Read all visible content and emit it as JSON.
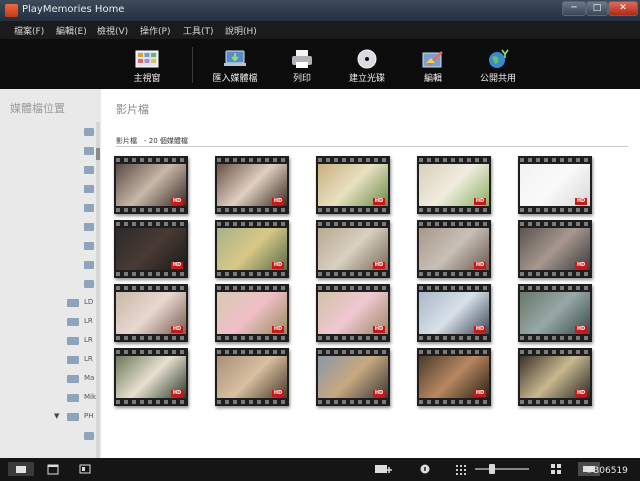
{
  "window": {
    "title": "PlayMemories Home",
    "buttons": {
      "minimize": "─",
      "maximize": "□",
      "close": "✕"
    }
  },
  "menu": [
    "檔案(F)",
    "編輯(E)",
    "檢視(V)",
    "操作(P)",
    "工具(T)",
    "說明(H)"
  ],
  "toolbar": [
    {
      "label": "主視窗",
      "icon": "main-window-icon"
    },
    {
      "label": "匯入媒體檔",
      "icon": "import-icon"
    },
    {
      "label": "列印",
      "icon": "printer-icon"
    },
    {
      "label": "建立光碟",
      "icon": "disc-icon"
    },
    {
      "label": "編輯",
      "icon": "edit-icon"
    },
    {
      "label": "公開共用",
      "icon": "globe-share-icon"
    }
  ],
  "sidebar": {
    "title": "媒體檔位置",
    "folders": [
      "",
      "",
      "",
      "",
      "",
      "",
      "",
      "",
      "",
      "LD",
      "LR",
      "LR",
      "LR",
      "Ma",
      "Mik",
      "PH",
      ""
    ]
  },
  "main": {
    "heading": "影片檔",
    "subheading": "影片檔　- 20 個媒體檔",
    "badge": "HD",
    "thumbnails": [
      {
        "colors": [
          "#5a4a45",
          "#c8b8a8",
          "#3a2a2a"
        ],
        "hd": true
      },
      {
        "colors": [
          "#6a5048",
          "#e0d0c0",
          "#3a2a22"
        ],
        "hd": true
      },
      {
        "colors": [
          "#c8b080",
          "#e8e0c0",
          "#6a8a4a"
        ],
        "hd": true
      },
      {
        "colors": [
          "#d8d0b8",
          "#f0ece0",
          "#8ab060"
        ],
        "hd": true
      },
      {
        "colors": [
          "#f2f2f2",
          "#fafafa",
          "#d8d8d8"
        ],
        "hd": true
      },
      {
        "colors": [
          "#2a2a2a",
          "#4a3a34",
          "#1a1a1a"
        ],
        "hd": true
      },
      {
        "colors": [
          "#a8b088",
          "#d8c888",
          "#5a6a48"
        ],
        "hd": true
      },
      {
        "colors": [
          "#b8a890",
          "#d8d0c0",
          "#7a6a58"
        ],
        "hd": true
      },
      {
        "colors": [
          "#a89888",
          "#c8c0b8",
          "#6a5a50"
        ],
        "hd": true
      },
      {
        "colors": [
          "#5a5450",
          "#a89890",
          "#3a3a3a"
        ],
        "hd": true
      },
      {
        "colors": [
          "#c8b8a8",
          "#e8d8d0",
          "#7a5a50"
        ],
        "hd": true
      },
      {
        "colors": [
          "#d8c8b0",
          "#f0c0c8",
          "#9a8a60"
        ],
        "hd": true
      },
      {
        "colors": [
          "#d0c0a8",
          "#f0c8d0",
          "#9a8868"
        ],
        "hd": true
      },
      {
        "colors": [
          "#a8b8c8",
          "#d8e0e8",
          "#3a4858"
        ],
        "hd": true
      },
      {
        "colors": [
          "#687868",
          "#98a8a8",
          "#3a4a48"
        ],
        "hd": true
      },
      {
        "colors": [
          "#6a7a5a",
          "#e8e0d0",
          "#2a3a2a"
        ],
        "hd": true
      },
      {
        "colors": [
          "#a89078",
          "#d8c0a0",
          "#4a3a2a"
        ],
        "hd": true
      },
      {
        "colors": [
          "#8a98a8",
          "#c8a880",
          "#3a3a3a"
        ],
        "hd": true
      },
      {
        "colors": [
          "#4a3a2a",
          "#b88860",
          "#2a2018"
        ],
        "hd": true
      },
      {
        "colors": [
          "#3a3228",
          "#c8b890",
          "#2a2a22"
        ],
        "hd": true
      }
    ]
  },
  "statusbar": {
    "left_icons": [
      "folder-view-icon",
      "calendar-view-icon",
      "photo-view-icon"
    ],
    "right_icons": [
      "add-media-icon",
      "info-icon",
      "small-grid-icon",
      "zoom-slider",
      "large-grid-icon",
      "detail-view-icon"
    ]
  },
  "watermark": "#306519",
  "colors": {
    "accent": "#c41a1a",
    "sidebar": "#e9e9ea",
    "toolbar": "#0c0c0c"
  }
}
